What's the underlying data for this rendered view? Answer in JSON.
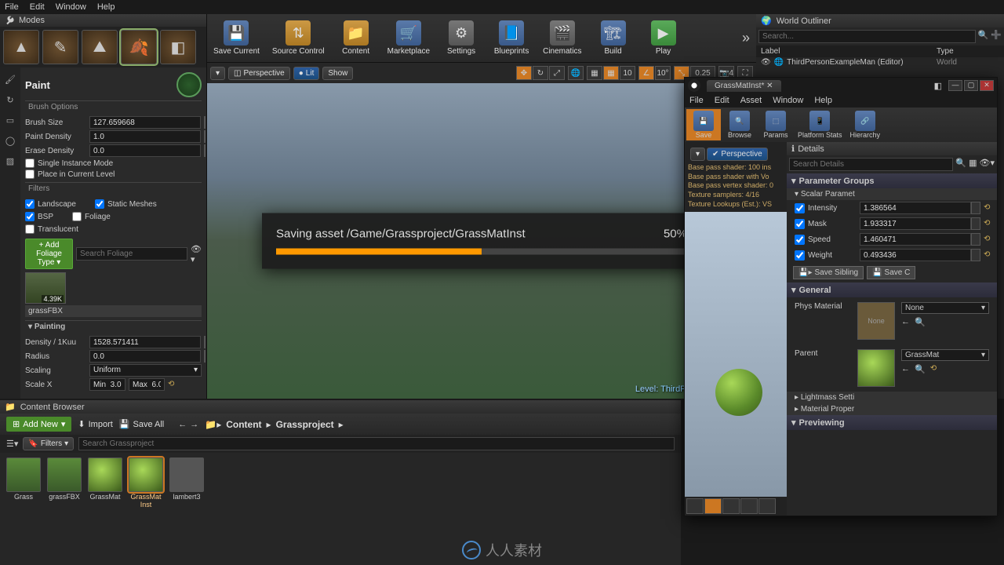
{
  "menubar": [
    "File",
    "Edit",
    "Window",
    "Help"
  ],
  "modes": {
    "title": "Modes"
  },
  "paint": {
    "title": "Paint",
    "section_brush": "Brush Options",
    "brush_size_label": "Brush Size",
    "brush_size": "127.659668",
    "paint_density_label": "Paint Density",
    "paint_density": "1.0",
    "erase_density_label": "Erase Density",
    "erase_density": "0.0",
    "single_instance": "Single Instance Mode",
    "place_current": "Place in Current Level",
    "section_filters": "Filters",
    "landscape": "Landscape",
    "static_meshes": "Static Meshes",
    "bsp": "BSP",
    "foliage": "Foliage",
    "translucent": "Translucent",
    "add_foliage": "+ Add Foliage Type",
    "search_foliage_ph": "Search Foliage",
    "thumb_label": "4.39K",
    "foliage_name": "grassFBX",
    "painting": "Painting",
    "density_label": "Density / 1Kuu",
    "density": "1528.571411",
    "radius_label": "Radius",
    "radius": "0.0",
    "scaling_label": "Scaling",
    "scaling": "Uniform",
    "scalex_label": "Scale X",
    "scalex_min": "Min  3.0",
    "scalex_max": "Max  6.0"
  },
  "toolbar": {
    "save_current": "Save Current",
    "source_control": "Source Control",
    "content": "Content",
    "marketplace": "Marketplace",
    "settings": "Settings",
    "blueprints": "Blueprints",
    "cinematics": "Cinematics",
    "build": "Build",
    "play": "Play"
  },
  "viewport": {
    "perspective": "Perspective",
    "lit": "Lit",
    "show": "Show",
    "snap_angle": "10",
    "snap_angle2": "10°",
    "snap_scale": "0.25",
    "cam_speed_ico": "4",
    "level_label": "Level: ",
    "level_name": "ThirdPersonExampleM"
  },
  "progress": {
    "text": "Saving asset /Game/Grassproject/GrassMatInst",
    "percent": "50%",
    "fill": 50
  },
  "outliner": {
    "title": "World Outliner",
    "search_ph": "Search...",
    "col_label": "Label",
    "col_type": "Type",
    "item_label": "ThirdPersonExampleMan (Editor)",
    "item_type": "World"
  },
  "mat": {
    "tab": "GrassMatInst*",
    "menubar": [
      "File",
      "Edit",
      "Asset",
      "Window",
      "Help"
    ],
    "tb": {
      "save": "Save",
      "browse": "Browse",
      "params": "Params",
      "platform_stats": "Platform Stats",
      "hierarchy": "Hierarchy"
    },
    "perspective": "Perspective",
    "shader_lines": [
      "Base pass shader: 100 ins",
      "Base pass shader with Vo",
      "Base pass vertex shader: 0",
      "Texture samplers: 4/16",
      "Texture Lookups (Est.): VS"
    ],
    "details": "Details",
    "search_details_ph": "Search Details",
    "param_groups": "Parameter Groups",
    "scalar_params": "Scalar Paramet",
    "params": [
      {
        "name": "Intensity",
        "value": "1.386564"
      },
      {
        "name": "Mask",
        "value": "1.933317"
      },
      {
        "name": "Speed",
        "value": "1.460471"
      },
      {
        "name": "Weight",
        "value": "0.493436"
      }
    ],
    "save_sibling": "Save Sibling",
    "save_child": "Save C",
    "general": "General",
    "phys_mat_label": "Phys Material",
    "phys_mat_val": "None",
    "phys_mat_thumb": "None",
    "parent_label": "Parent",
    "parent_val": "GrassMat",
    "lightmass": "Lightmass Setti",
    "mat_prop": "Material Proper",
    "previewing": "Previewing"
  },
  "cb": {
    "title": "Content Browser",
    "add_new": "Add New",
    "import": "Import",
    "save_all": "Save All",
    "crumb1": "Content",
    "crumb2": "Grassproject",
    "filters": "Filters",
    "search_ph": "Search Grassproject",
    "assets": [
      {
        "name": "Grass",
        "kind": "flat"
      },
      {
        "name": "grassFBX",
        "kind": "flat"
      },
      {
        "name": "GrassMat",
        "kind": "sphere"
      },
      {
        "name": "GrassMat\nInst",
        "kind": "sphere",
        "sel": true
      },
      {
        "name": "lambert3",
        "kind": "gray"
      }
    ]
  },
  "brand": "人人素材"
}
